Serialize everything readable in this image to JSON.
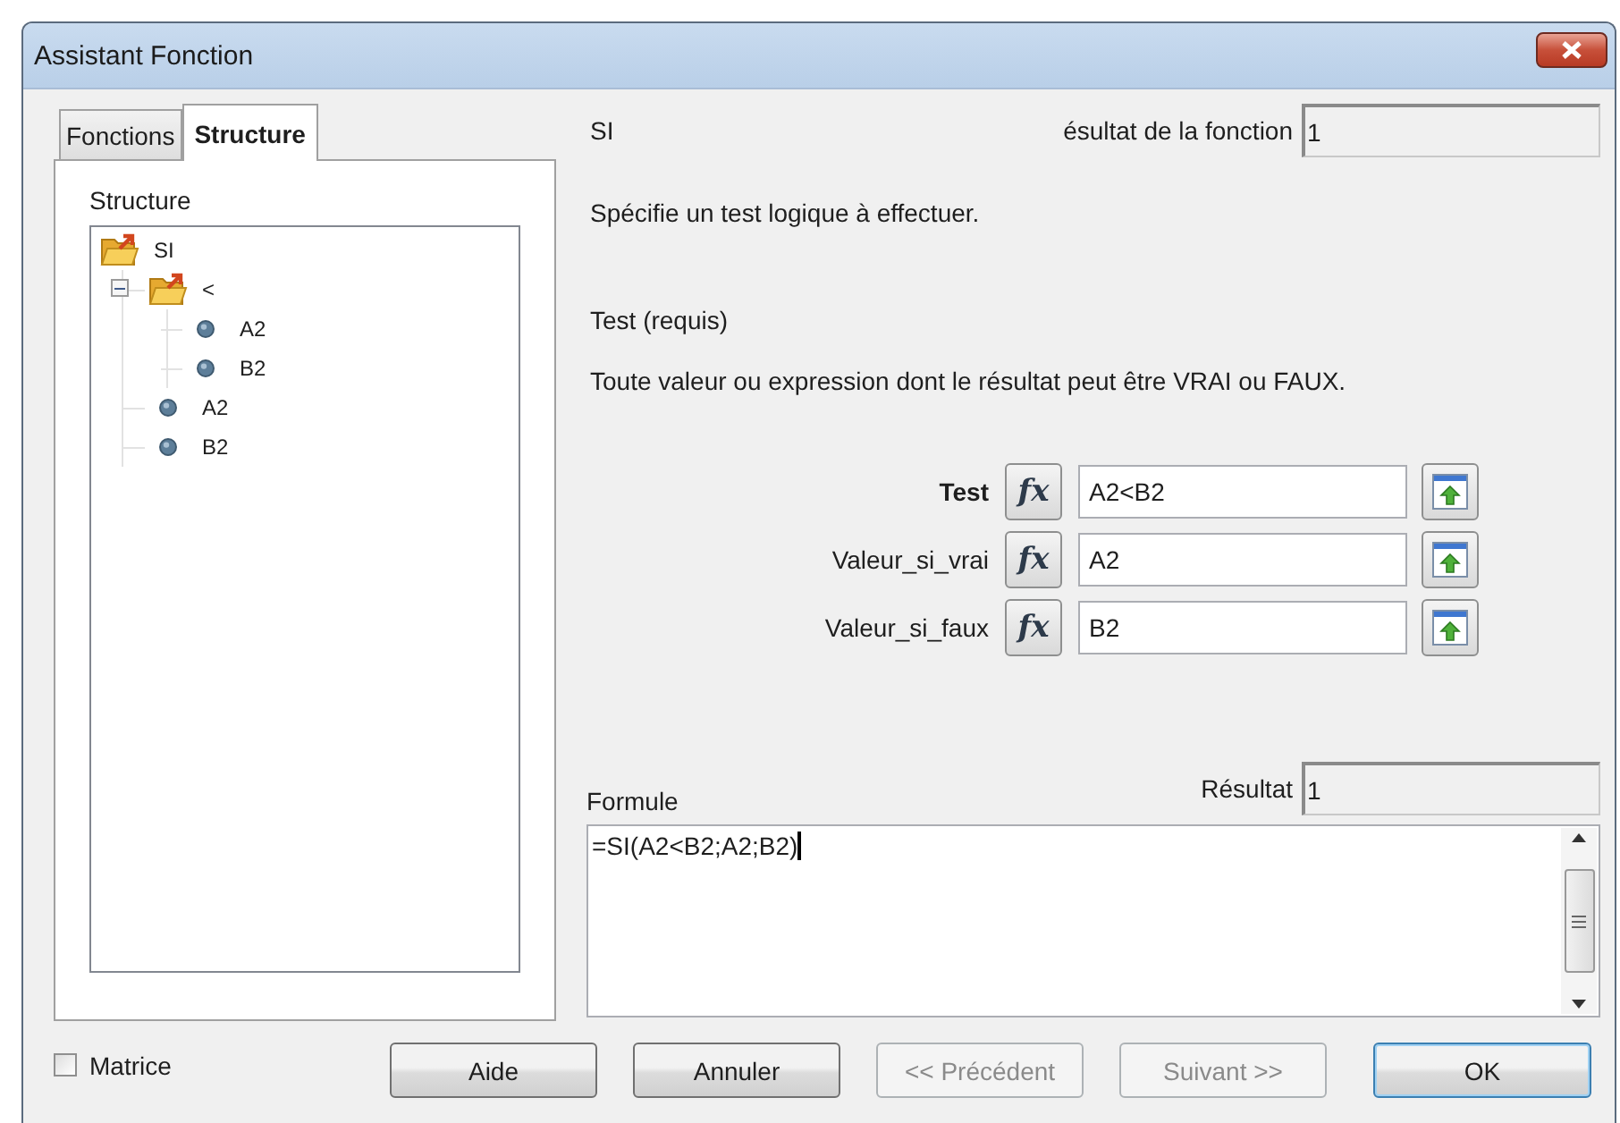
{
  "window": {
    "title": "Assistant Fonction"
  },
  "tabs": [
    {
      "label": "Fonctions",
      "selected": false
    },
    {
      "label": "Structure",
      "selected": true
    }
  ],
  "structure": {
    "label": "Structure",
    "tree": [
      {
        "label": "SI",
        "kind": "function",
        "children": [
          {
            "label": "<",
            "kind": "function",
            "expanded": true,
            "children": [
              {
                "label": "A2",
                "kind": "value"
              },
              {
                "label": "B2",
                "kind": "value"
              }
            ]
          },
          {
            "label": "A2",
            "kind": "value"
          },
          {
            "label": "B2",
            "kind": "value"
          }
        ]
      }
    ]
  },
  "function": {
    "name": "SI",
    "result_label": "ésultat de la fonction",
    "result": "1",
    "description": "Spécifie un test logique à effectuer.",
    "argument_title": "Test (requis)",
    "argument_description": "Toute valeur ou expression dont le résultat peut être VRAI ou FAUX."
  },
  "arguments": [
    {
      "label": "Test",
      "selected": true,
      "fx": "fx",
      "value": "A2<B2"
    },
    {
      "label": "Valeur_si_vrai",
      "selected": false,
      "fx": "fx",
      "value": "A2"
    },
    {
      "label": "Valeur_si_faux",
      "selected": false,
      "fx": "fx",
      "value": "B2"
    }
  ],
  "formula": {
    "label": "Formule",
    "result_label": "Résultat",
    "result": "1",
    "value": "=SI(A2<B2;A2;B2)"
  },
  "matrix": {
    "label": "Matrice",
    "checked": false
  },
  "buttons": [
    {
      "label": "Aide",
      "disabled": false,
      "default": false
    },
    {
      "label": "Annuler",
      "disabled": false,
      "default": false
    },
    {
      "label": "<< Précédent",
      "disabled": true,
      "default": false
    },
    {
      "label": "Suivant >>",
      "disabled": true,
      "default": false
    },
    {
      "label": "OK",
      "disabled": false,
      "default": true
    }
  ]
}
